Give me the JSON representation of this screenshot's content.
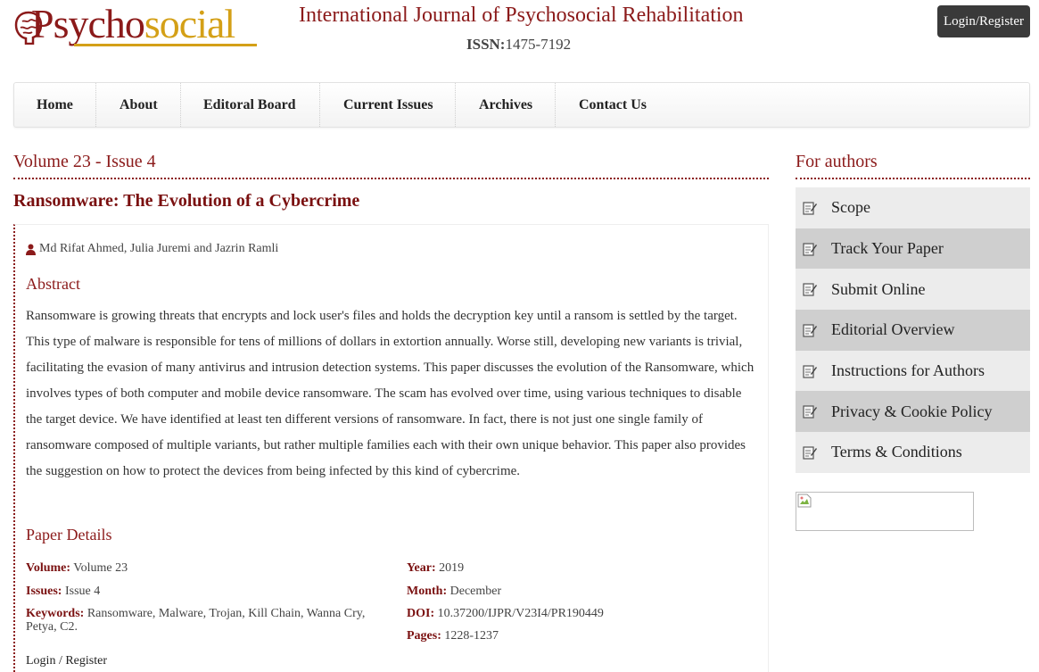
{
  "header": {
    "logo_text_part1": "Psycho",
    "logo_text_part2": "social",
    "journal_title": "International Journal of Psychosocial Rehabilitation",
    "issn_label": "ISSN:",
    "issn_value": "1475-7192",
    "login_button": "Login/Register"
  },
  "nav": {
    "items": [
      "Home",
      "About",
      "Editoral Board",
      "Current Issues",
      "Archives",
      "Contact Us"
    ]
  },
  "main": {
    "volume_heading": "Volume 23 - Issue 4",
    "paper_title": "Ransomware: The Evolution of a Cybercrime",
    "authors": "Md Rifat Ahmed, Julia Juremi and Jazrin Ramli",
    "abstract_heading": "Abstract",
    "abstract_text": "Ransomware is growing threats that encrypts and lock user's files and holds the decryption key until a ransom is settled by the target. This type of malware is responsible for tens of millions of dollars in extortion annually. Worse still, developing new variants is trivial, facilitating the evasion of many antivirus and intrusion detection systems. This paper discusses the evolution of the Ransomware, which involves types of both computer and mobile device ransomware. The scam has evolved over time, using various techniques to disable the target device. We have identified at least ten different versions of ransomware. In fact, there is not just one single family of ransomware composed of multiple variants, but rather multiple families each with their own unique behavior. This paper also provides the suggestion on how to protect the devices from being infected by this kind of cybercrime.",
    "details_heading": "Paper Details",
    "details": {
      "volume_label": "Volume:",
      "volume_value": "Volume 23",
      "issues_label": "Issues:",
      "issues_value": "Issue 4",
      "keywords_label": "Keywords:",
      "keywords_value": "Ransomware, Malware, Trojan, Kill Chain, Wanna Cry, Petya, C2.",
      "year_label": "Year:",
      "year_value": "2019",
      "month_label": "Month:",
      "month_value": "December",
      "doi_label": "DOI:",
      "doi_value": "10.37200/IJPR/V23I4/PR190449",
      "pages_label": "Pages:",
      "pages_value": "1228-1237"
    },
    "login_link": "Login",
    "login_separator": " / ",
    "register_link": "Register"
  },
  "sidebar": {
    "heading": "For authors",
    "items": [
      "Scope",
      "Track Your Paper",
      "Submit Online",
      "Editorial Overview",
      "Instructions for Authors",
      "Privacy & Cookie Policy",
      "Terms & Conditions"
    ]
  },
  "colors": {
    "brand": "#8b1a1a",
    "logo_gold": "#d4a017",
    "login_bg": "#3a3a3a"
  },
  "icons": {
    "author": "user-icon",
    "sidebar_item": "note-icon",
    "sidebar_image": "broken-image-icon"
  }
}
